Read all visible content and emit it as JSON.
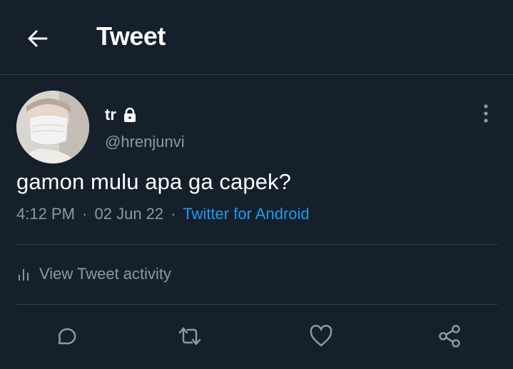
{
  "header": {
    "back_icon": "arrow-left-icon",
    "title": "Tweet"
  },
  "tweet": {
    "author": {
      "name": "tr",
      "protected_icon": "lock-icon",
      "handle": "@hrenjunvi"
    },
    "text": "gamon mulu apa ga capek?",
    "time": "4:12 PM",
    "date": "02 Jun 22",
    "separator": "·",
    "source": "Twitter for Android"
  },
  "activity": {
    "label": "View Tweet activity",
    "icon": "bar-chart-icon"
  },
  "actions": {
    "reply_icon": "reply-icon",
    "retweet_icon": "retweet-icon",
    "like_icon": "heart-icon",
    "share_icon": "share-icon"
  },
  "colors": {
    "background": "#15202b",
    "divider": "#38444d",
    "secondary_text": "#8b98a5",
    "accent": "#1d9bf0"
  }
}
